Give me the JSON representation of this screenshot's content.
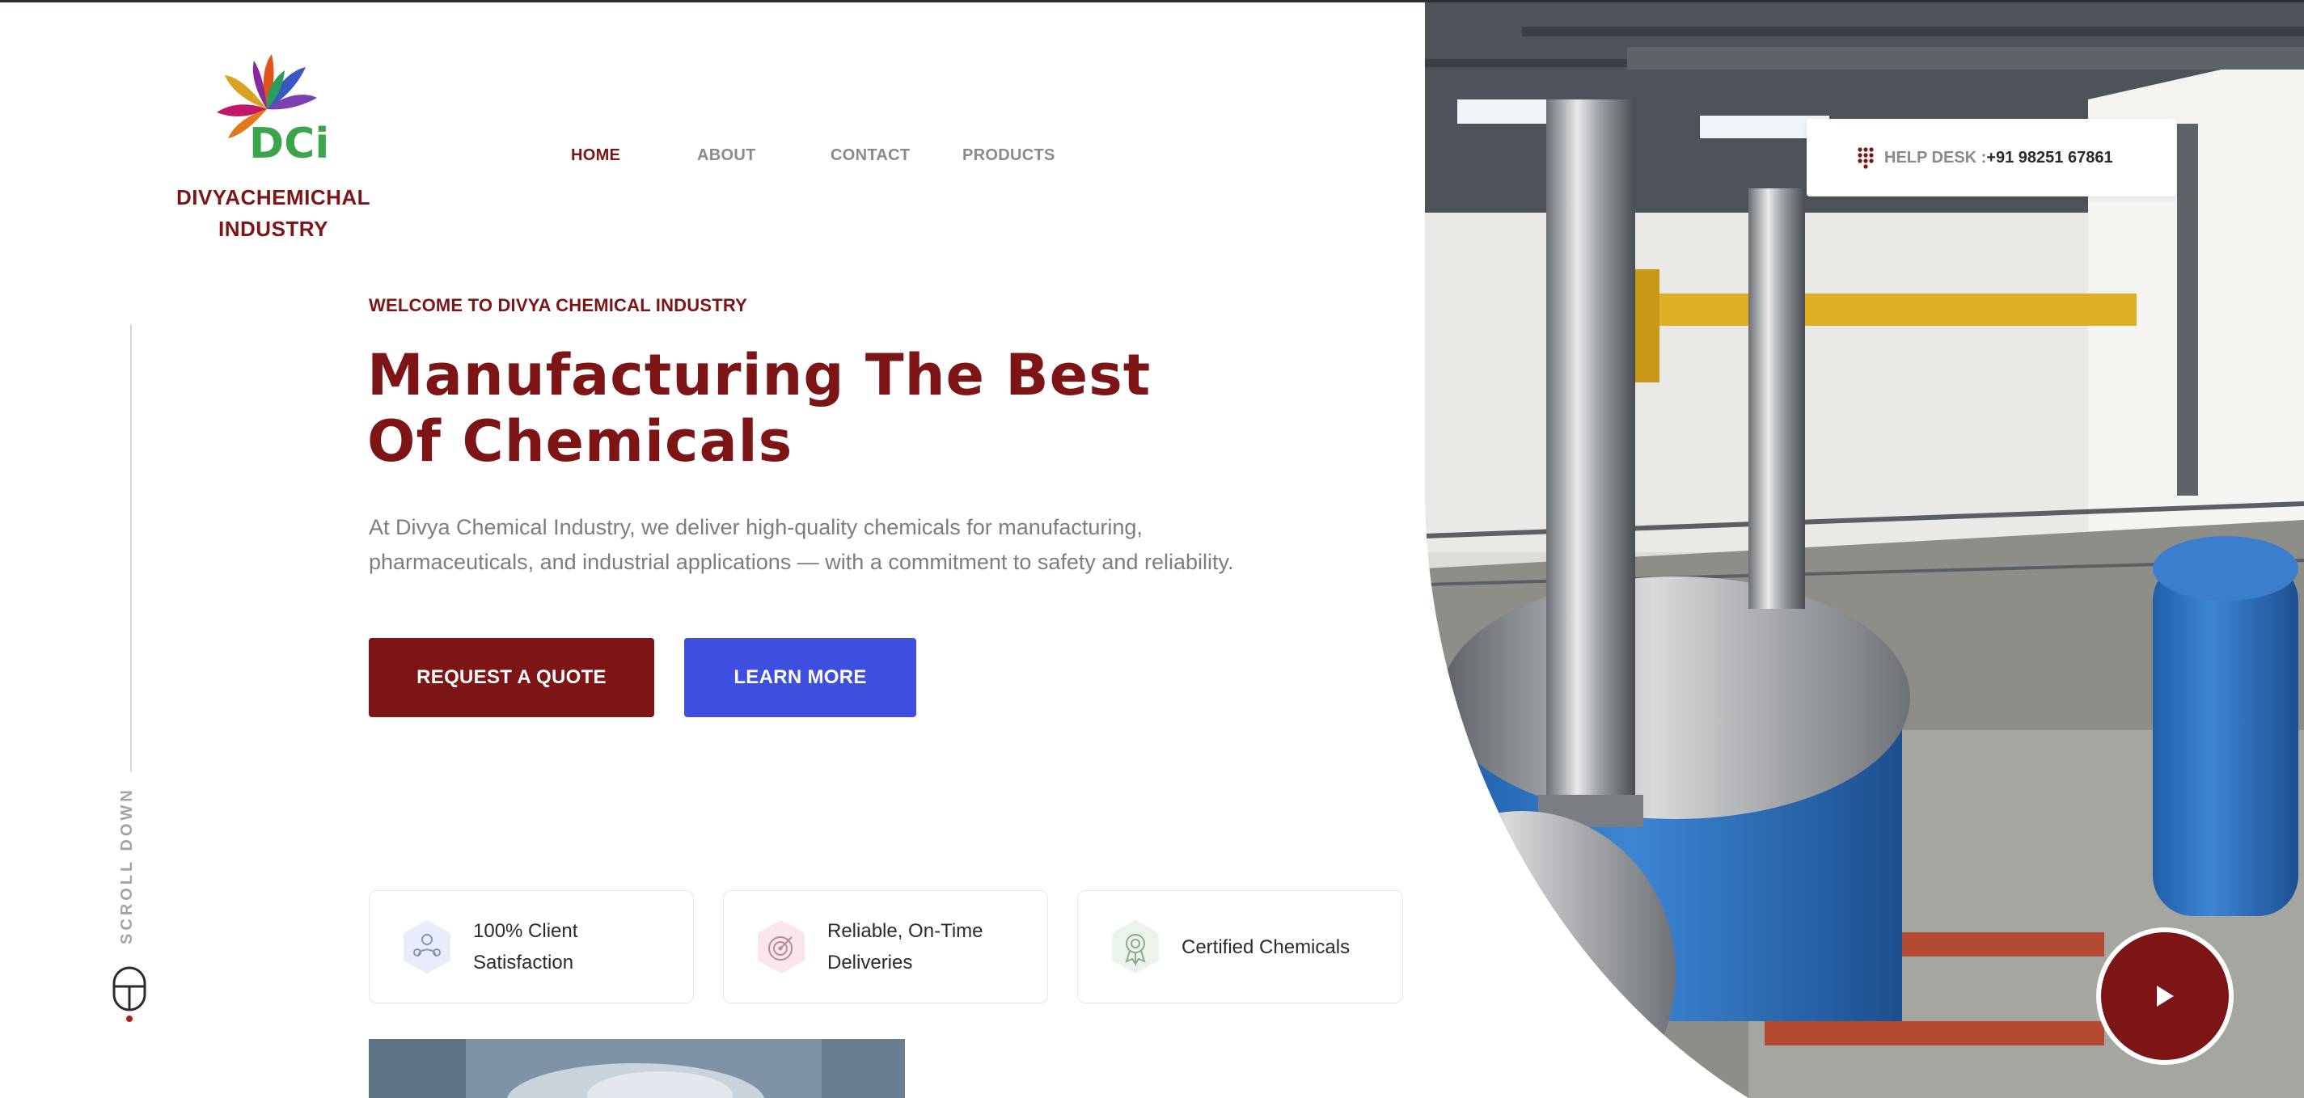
{
  "brand": {
    "line1": "DIVYACHEMICHAL",
    "line2": "INDUSTRY",
    "logo_text": "DCi"
  },
  "nav": {
    "items": [
      {
        "label": "HOME",
        "active": true
      },
      {
        "label": "ABOUT",
        "active": false
      },
      {
        "label": "CONTACT",
        "active": false
      },
      {
        "label": "PRODUCTS",
        "active": false
      }
    ]
  },
  "help_desk": {
    "label": "HELP DESK :",
    "phone": "+91 98251 67861",
    "icon": "dialpad-icon"
  },
  "hero": {
    "welcome": "WELCOME TO DIVYA CHEMICAL INDUSTRY",
    "headline_line1": "Manufacturing The Best",
    "headline_line2": "Of Chemicals",
    "lead": "At Divya Chemical Industry, we deliver high-quality chemicals for manufacturing, pharmaceuticals, and industrial applications — with a commitment to safety and reliability.",
    "primary_button": "REQUEST A QUOTE",
    "secondary_button": "LEARN MORE"
  },
  "scroll": {
    "label": "SCROLL DOWN",
    "icon": "mouse-icon"
  },
  "features": [
    {
      "line1": "100% Client",
      "line2": "Satisfaction",
      "icon": "users-icon"
    },
    {
      "line1": "Reliable, On-Time",
      "line2": "Deliveries",
      "icon": "target-icon"
    },
    {
      "line1": "Certified Chemicals",
      "line2": "",
      "icon": "award-icon"
    }
  ],
  "colors": {
    "brand": "#7d1416",
    "accent_blue": "#3e4fe0",
    "muted_text": "#7d7d7d"
  }
}
